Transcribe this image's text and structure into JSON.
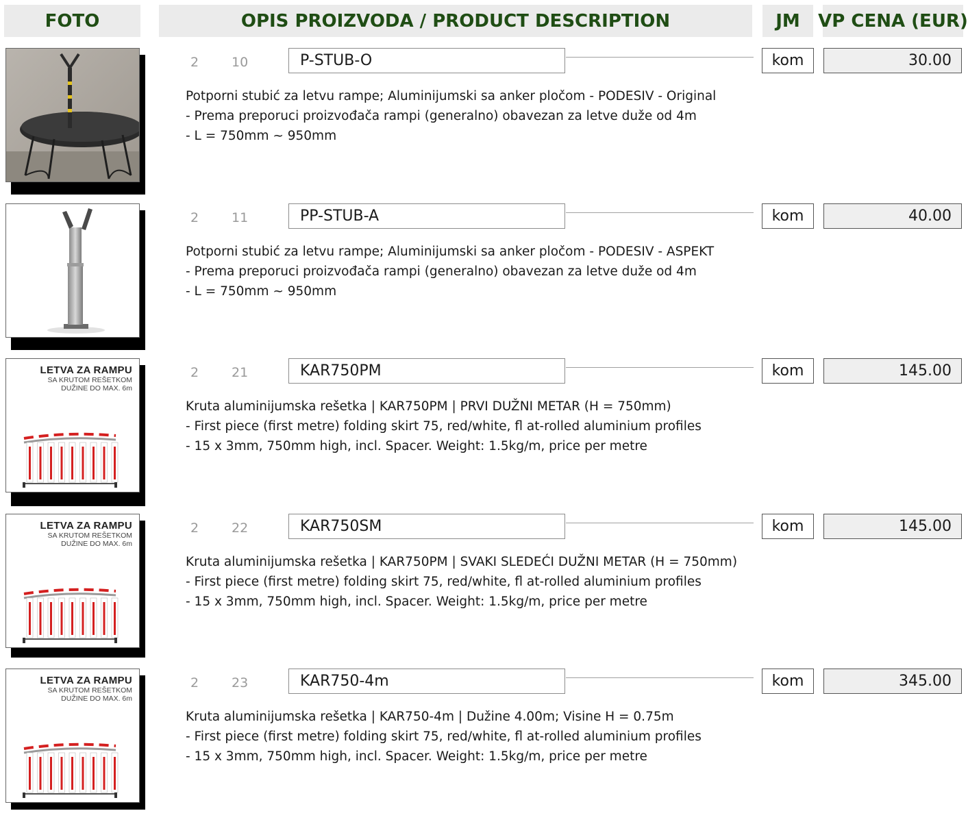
{
  "header": {
    "foto": "FOTO",
    "description": "OPIS PROIZVODA / PRODUCT DESCRIPTION",
    "unit": "JM",
    "price": "VP CENA (EUR)"
  },
  "colors": {
    "header_text": "#1f4d14",
    "header_bg": "#ebebeb",
    "price_bg": "#efefef",
    "barrier_red": "#d42020"
  },
  "sign": {
    "title": "LETVA  ZA RAMPU",
    "line1": "SA KRUTOM REŠETKOM",
    "line2": "DUŽINE DO MAX. 6m"
  },
  "products": [
    {
      "col1": "2",
      "col2": "10",
      "code": "P-STUB-O",
      "unit": "kom",
      "price": "30.00",
      "photo": "table-support-photo",
      "lines": [
        "Potporni stubić za letvu rampe; Aluminijumski sa anker pločom - PODESIV - Original",
        " - Prema preporuci proizvođača rampi (generalno) obavezan za letve duže od 4m",
        " - L = 750mm ~ 950mm"
      ]
    },
    {
      "col1": "2",
      "col2": "11",
      "code": "PP-STUB-A",
      "unit": "kom",
      "price": "40.00",
      "photo": "support-post-photo",
      "lines": [
        "Potporni stubić za letvu rampe; Aluminijumski sa anker pločom - PODESIV - ASPEKT",
        " - Prema preporuci proizvođača rampi (generalno) obavezan za letve duže od 4m",
        " - L = 750mm ~ 950mm"
      ]
    },
    {
      "col1": "2",
      "col2": "21",
      "code": "KAR750PM",
      "unit": "kom",
      "price": "145.00",
      "photo": "barrier-skirt-sign",
      "lines": [
        "Kruta aluminijumska rešetka | KAR750PM | PRVI DUŽNI METAR  (H = 750mm)",
        " - First piece (first metre) folding skirt 75, red/white, fl at-rolled aluminium profiles",
        " - 15 x 3mm, 750mm high, incl. Spacer. Weight: 1.5kg/m, price per metre"
      ]
    },
    {
      "col1": "2",
      "col2": "22",
      "code": "KAR750SM",
      "unit": "kom",
      "price": "145.00",
      "photo": "barrier-skirt-sign",
      "lines": [
        "Kruta aluminijumska rešetka | KAR750PM | SVAKI SLEDEĆI DUŽNI METAR  (H = 750mm)",
        " - First piece (first metre) folding skirt 75, red/white, fl at-rolled aluminium profiles",
        " - 15 x 3mm, 750mm high, incl. Spacer. Weight: 1.5kg/m, price per metre"
      ]
    },
    {
      "col1": "2",
      "col2": "23",
      "code": "KAR750-4m",
      "unit": "kom",
      "price": "345.00",
      "photo": "barrier-skirt-sign",
      "lines": [
        "Kruta aluminijumska rešetka | KAR750-4m | Dužine 4.00m; Visine H = 0.75m",
        " - First piece (first metre) folding skirt 75, red/white, fl at-rolled aluminium profiles",
        " - 15 x 3mm, 750mm high, incl. Spacer. Weight: 1.5kg/m, price per metre"
      ]
    }
  ]
}
